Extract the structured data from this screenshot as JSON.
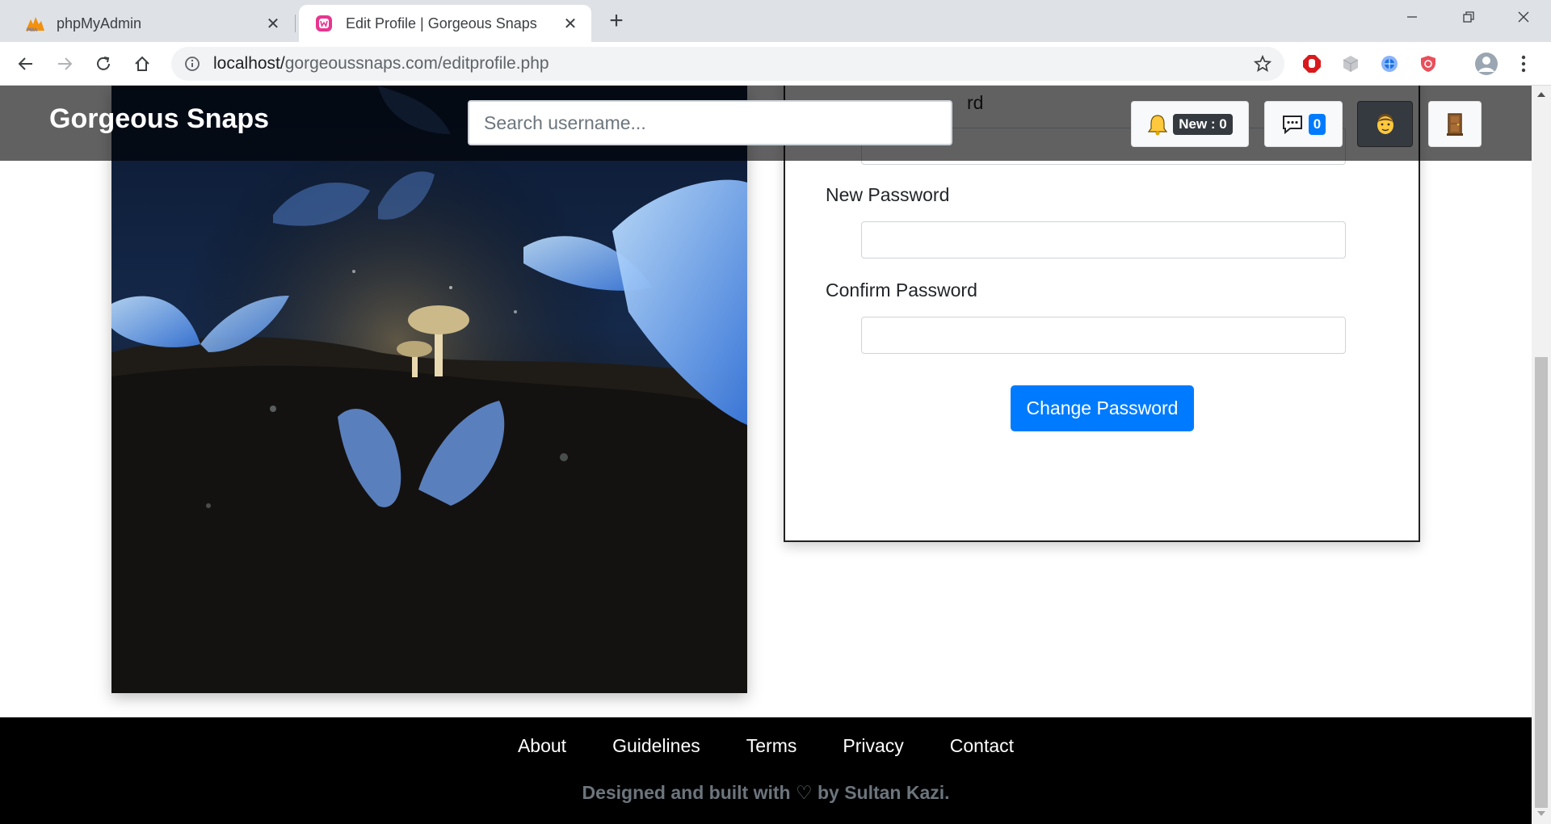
{
  "browser": {
    "tabs": [
      {
        "title": "phpMyAdmin",
        "favicon": "phpmyadmin-logo",
        "active": false
      },
      {
        "title": "Edit Profile | Gorgeous Snaps",
        "favicon": "wamp-logo",
        "active": true
      }
    ],
    "url_host": "localhost/",
    "url_path": "gorgeoussnaps.com/editprofile.php"
  },
  "navbar": {
    "brand": "Gorgeous Snaps",
    "search_placeholder": "Search username...",
    "notifications_label": "New : 0",
    "messages_count": "0"
  },
  "form": {
    "partial_label": "rd",
    "new_password_label": "New Password",
    "confirm_password_label": "Confirm Password",
    "submit_label": "Change Password"
  },
  "footer": {
    "links": [
      "About",
      "Guidelines",
      "Terms",
      "Privacy",
      "Contact"
    ],
    "credit": "Designed and built with ♡ by Sultan Kazi."
  },
  "colors": {
    "primary": "#007bff",
    "navbar_overlay": "#000000",
    "footer_bg": "#000000",
    "badge_dark": "#343a40"
  }
}
